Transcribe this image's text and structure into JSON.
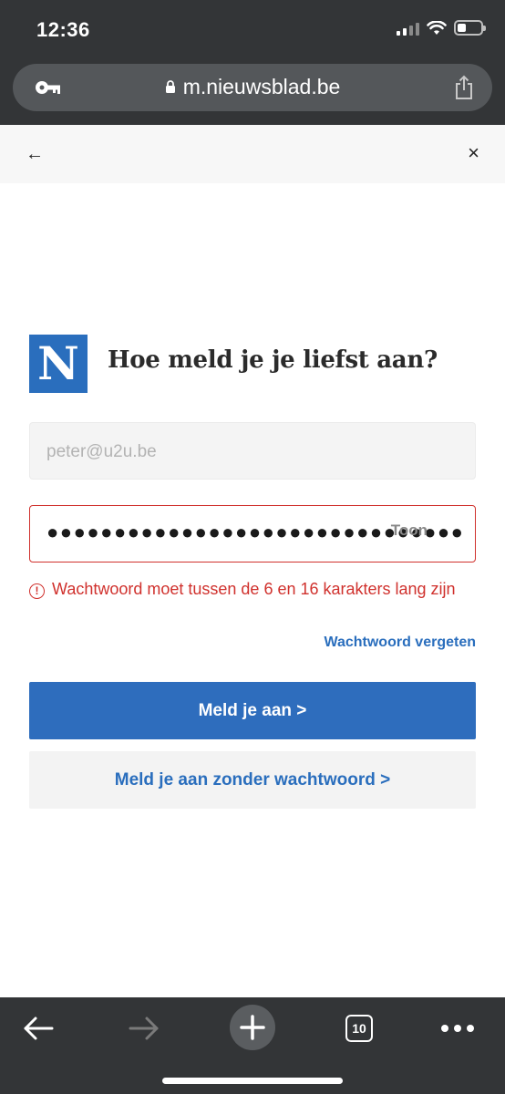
{
  "status_bar": {
    "time": "12:36"
  },
  "browser": {
    "url": "m.nieuwsblad.be",
    "key_icon": "key-icon",
    "lock_icon": "lock-icon",
    "share_icon": "share-icon"
  },
  "header": {
    "back_icon": "←",
    "close_icon": "×"
  },
  "login": {
    "logo_letter": "N",
    "heading": "Hoe meld je je liefst aan?",
    "email_placeholder": "peter@u2u.be",
    "password_masked": "●●●●●●●●●●●●●●●●●●●●●●●●●●●●●●●●●●",
    "show_label": "Toon",
    "error_icon": "!",
    "error_text": "Wachtwoord moet tussen de 6 en 16 karakters lang zijn",
    "forgot_label": "Wachtwoord vergeten",
    "login_button": "Meld je aan >",
    "passwordless_button": "Meld je aan zonder wachtwoord >"
  },
  "toolbar": {
    "tab_count": "10"
  },
  "colors": {
    "brand_blue": "#2e6dbd",
    "error_red": "#d0312d",
    "chrome_dark": "#333537"
  }
}
